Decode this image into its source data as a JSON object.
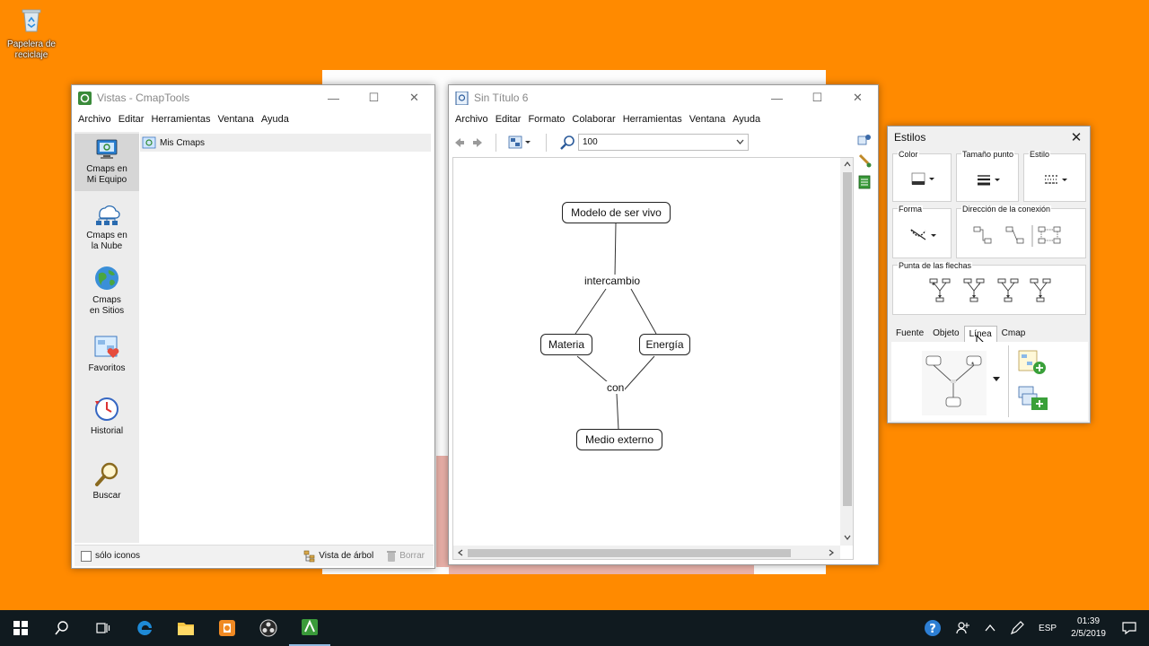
{
  "desktop": {
    "recycle_bin_label": "Papelera de reciclaje"
  },
  "vistas": {
    "title": "Vistas - CmapTools",
    "menu": [
      "Archivo",
      "Editar",
      "Herramientas",
      "Ventana",
      "Ayuda"
    ],
    "nav": [
      {
        "line1": "Cmaps en",
        "line2": "Mi Equipo",
        "icon": "computer-icon"
      },
      {
        "line1": "Cmaps en",
        "line2": "la Nube",
        "icon": "cloud-network-icon"
      },
      {
        "line1": "Cmaps",
        "line2": "en Sitios",
        "icon": "globe-icon"
      },
      {
        "line1": "Favoritos",
        "line2": "",
        "icon": "favorites-icon"
      },
      {
        "line1": "Historial",
        "line2": "",
        "icon": "history-icon"
      },
      {
        "line1": "Buscar",
        "line2": "",
        "icon": "search-icon"
      }
    ],
    "tree_item": "Mis Cmaps",
    "status": {
      "icons_only": "sólo iconos",
      "tree_view": "Vista de árbol",
      "delete": "Borrar"
    }
  },
  "editor": {
    "title": "Sin Título 6",
    "menu": [
      "Archivo",
      "Editar",
      "Formato",
      "Colaborar",
      "Herramientas",
      "Ventana",
      "Ayuda"
    ],
    "zoom": "100",
    "concepts": {
      "root": "Modelo de ser vivo",
      "left": "Materia",
      "right": "Energía",
      "bottom": "Medio externo"
    },
    "links": {
      "top": "intercambio",
      "bottom": "con"
    }
  },
  "estilos": {
    "title": "Estilos",
    "groups": {
      "color": "Color",
      "point_size": "Tamaño punto",
      "style": "Estilo",
      "shape": "Forma",
      "direction": "Dirección de la conexión",
      "arrowheads": "Punta de las flechas"
    },
    "tabs": [
      "Fuente",
      "Objeto",
      "Línea",
      "Cmap"
    ],
    "selected_tab": "Línea"
  },
  "taskbar": {
    "language": "ESP",
    "time": "01:39",
    "date": "2/5/2019"
  }
}
